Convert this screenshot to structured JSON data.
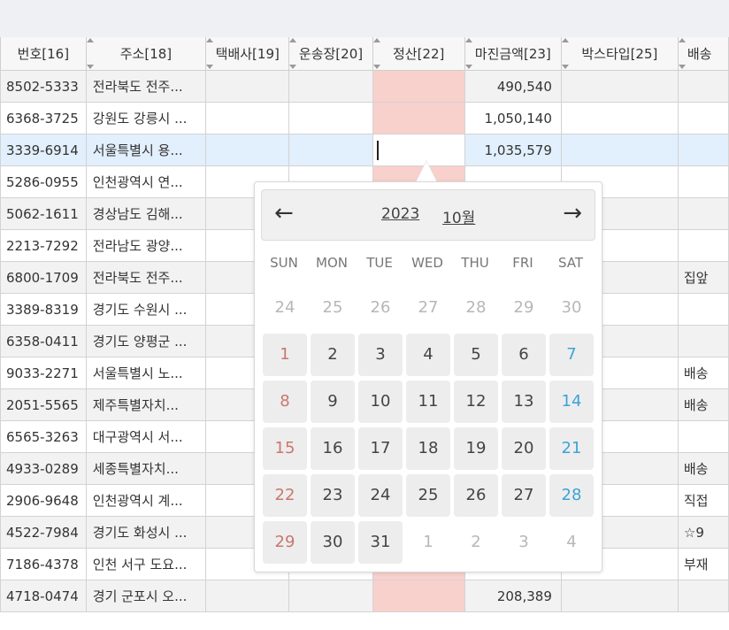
{
  "grid": {
    "columns": [
      "번호[16]",
      "주소[18]",
      "택배사[19]",
      "운송장[20]",
      "정산[22]",
      "마진금액[23]",
      "박스타입[25]",
      "배송"
    ],
    "rows": [
      {
        "phone": "8502-5333",
        "addr": "전라북도 전주...",
        "amount": "490,540",
        "memo": ""
      },
      {
        "phone": "6368-3725",
        "addr": "강원도 강릉시 ...",
        "amount": "1,050,140",
        "memo": ""
      },
      {
        "phone": "3339-6914",
        "addr": "서울특별시 용...",
        "amount": "1,035,579",
        "memo": ""
      },
      {
        "phone": "5286-0955",
        "addr": "인천광역시 연...",
        "amount": "",
        "memo": ""
      },
      {
        "phone": "5062-1611",
        "addr": "경상남도 김해...",
        "amount": "",
        "memo": ""
      },
      {
        "phone": "2213-7292",
        "addr": "전라남도 광양...",
        "amount": "",
        "memo": ""
      },
      {
        "phone": "6800-1709",
        "addr": "전라북도 전주...",
        "amount": "",
        "memo": "집앞"
      },
      {
        "phone": "3389-8319",
        "addr": "경기도 수원시 ...",
        "amount": "",
        "memo": ""
      },
      {
        "phone": "6358-0411",
        "addr": "경기도 양평군 ...",
        "amount": "",
        "memo": ""
      },
      {
        "phone": "9033-2271",
        "addr": "서울특별시 노...",
        "amount": "",
        "memo": "배송"
      },
      {
        "phone": "2051-5565",
        "addr": "제주특별자치...",
        "amount": "",
        "memo": "배송"
      },
      {
        "phone": "6565-3263",
        "addr": "대구광역시 서...",
        "amount": "",
        "memo": ""
      },
      {
        "phone": "4933-0289",
        "addr": "세종특별자치...",
        "amount": "",
        "memo": "배송"
      },
      {
        "phone": "2906-9648",
        "addr": "인천광역시 계...",
        "amount": "",
        "memo": "직접"
      },
      {
        "phone": "4522-7984",
        "addr": "경기도 화성시 ...",
        "amount": "",
        "memo": "☆9"
      },
      {
        "phone": "7186-4378",
        "addr": "인천 서구 도요...",
        "amount": "",
        "memo": "부재"
      },
      {
        "phone": "4718-0474",
        "addr": "경기 군포시 오...",
        "amount": "208,389",
        "memo": ""
      }
    ],
    "selected_row": 2
  },
  "datepicker": {
    "prev_icon": "←",
    "next_icon": "→",
    "year": "2023",
    "month": "10월",
    "weekdays": [
      "SUN",
      "MON",
      "TUE",
      "WED",
      "THU",
      "FRI",
      "SAT"
    ],
    "weeks": [
      [
        "24",
        "25",
        "26",
        "27",
        "28",
        "29",
        "30"
      ],
      [
        "1",
        "2",
        "3",
        "4",
        "5",
        "6",
        "7"
      ],
      [
        "8",
        "9",
        "10",
        "11",
        "12",
        "13",
        "14"
      ],
      [
        "15",
        "16",
        "17",
        "18",
        "19",
        "20",
        "21"
      ],
      [
        "22",
        "23",
        "24",
        "25",
        "26",
        "27",
        "28"
      ],
      [
        "29",
        "30",
        "31",
        "1",
        "2",
        "3",
        "4"
      ]
    ],
    "colors": {
      "sunday": "#c9776c",
      "saturday": "#3aa3d8",
      "other_month": "#b7b7b7"
    }
  }
}
